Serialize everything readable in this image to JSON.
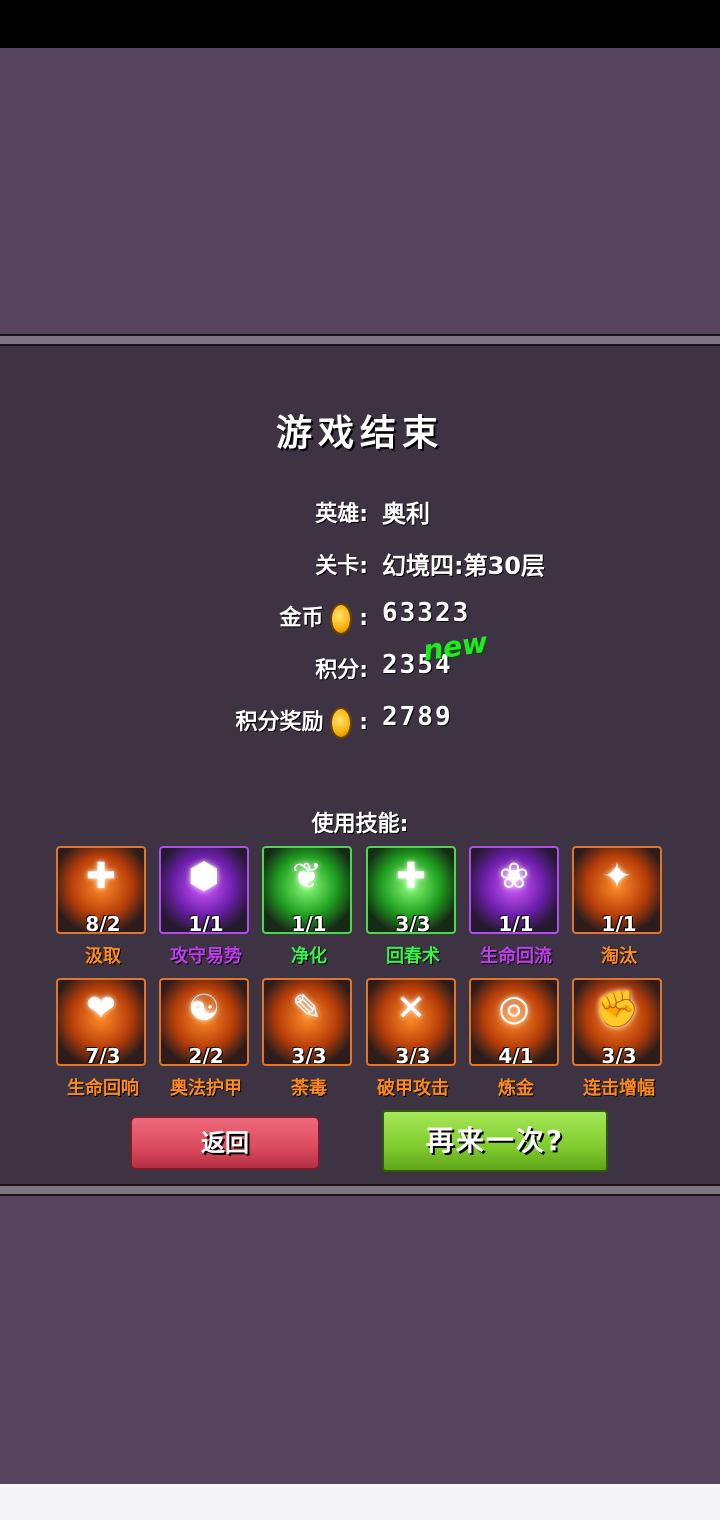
{
  "title": "游戏结束",
  "info": {
    "hero_label": "英雄:",
    "hero_value": "奥利",
    "stage_label": "关卡:",
    "stage_value": "幻境四:第30层",
    "gold_label": "金币",
    "gold_colon": ":",
    "gold_value": "63323",
    "score_label": "积分:",
    "score_value": "2354",
    "new_badge": "new",
    "reward_label": "积分奖励",
    "reward_colon": ":",
    "reward_value": "2789"
  },
  "skills_title": "使用技能:",
  "skills": [
    {
      "name": "汲取",
      "count": "8/2",
      "theme": "orange",
      "icon": "✚"
    },
    {
      "name": "攻守易势",
      "count": "1/1",
      "theme": "purple",
      "icon": "⬢"
    },
    {
      "name": "净化",
      "count": "1/1",
      "theme": "green",
      "icon": "❦"
    },
    {
      "name": "回春术",
      "count": "3/3",
      "theme": "green",
      "icon": "✚"
    },
    {
      "name": "生命回流",
      "count": "1/1",
      "theme": "purple",
      "icon": "❀"
    },
    {
      "name": "淘汰",
      "count": "1/1",
      "theme": "orange",
      "icon": "✦"
    },
    {
      "name": "生命回响",
      "count": "7/3",
      "theme": "orange",
      "icon": "❤"
    },
    {
      "name": "奥法护甲",
      "count": "2/2",
      "theme": "orange",
      "icon": "☯"
    },
    {
      "name": "荼毒",
      "count": "3/3",
      "theme": "orange",
      "icon": "✎"
    },
    {
      "name": "破甲攻击",
      "count": "3/3",
      "theme": "orange",
      "icon": "✕"
    },
    {
      "name": "炼金",
      "count": "4/1",
      "theme": "orange",
      "icon": "◎"
    },
    {
      "name": "连击增幅",
      "count": "3/3",
      "theme": "orange",
      "icon": "✊"
    }
  ],
  "colors": {
    "orange": "#ff8a1c",
    "purple": "#c23cf0",
    "green": "#34f24a"
  },
  "buttons": {
    "back": "返回",
    "retry": "再来一次?"
  }
}
